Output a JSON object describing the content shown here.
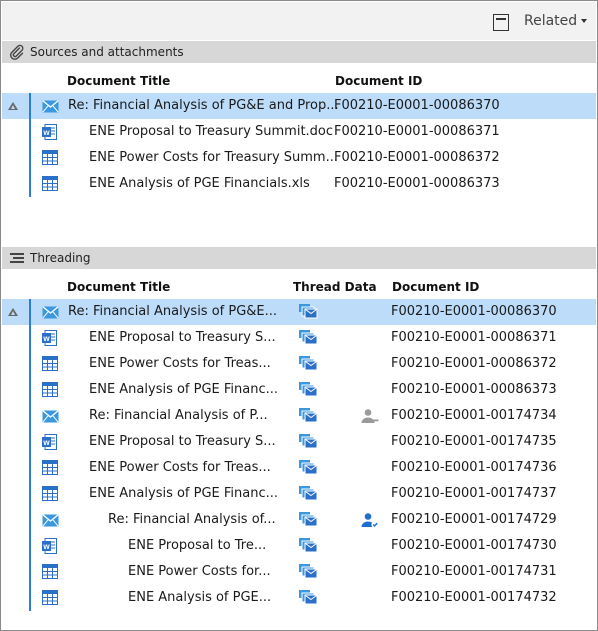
{
  "toolbar": {
    "related_label": "Related",
    "icons": {
      "panel_toggle": "panel-toggle-icon",
      "caret": "caret-down-icon"
    }
  },
  "sources": {
    "title": "Sources and attachments",
    "section_icon": "paperclip-icon",
    "columns": {
      "title": "Document Title",
      "doc_id": "Document ID"
    },
    "rows": [
      {
        "icon": "email-icon",
        "title": "Re: Financial Analysis of PG&E and Prop...",
        "doc_id": "F00210-E0001-00086370",
        "selected": true,
        "indent": 0
      },
      {
        "icon": "word-doc-icon",
        "title": "ENE Proposal to Treasury Summit.doc",
        "doc_id": "F00210-E0001-00086371",
        "indent": 1
      },
      {
        "icon": "spreadsheet-icon",
        "title": "ENE Power Costs for Treasury Summ...",
        "doc_id": "F00210-E0001-00086372",
        "indent": 1
      },
      {
        "icon": "spreadsheet-icon",
        "title": "ENE Analysis of PGE Financials.xls",
        "doc_id": "F00210-E0001-00086373",
        "indent": 1
      }
    ]
  },
  "threading": {
    "title": "Threading",
    "section_icon": "threading-icon",
    "columns": {
      "title": "Document Title",
      "thread_data": "Thread Data",
      "doc_id": "Document ID"
    },
    "rows": [
      {
        "icon": "email-icon",
        "title": "Re: Financial Analysis of PG&E...",
        "doc_id": "F00210-E0001-00086370",
        "selected": true,
        "indent": 0,
        "person": null
      },
      {
        "icon": "word-doc-icon",
        "title": "ENE Proposal to Treasury S...",
        "doc_id": "F00210-E0001-00086371",
        "indent": 1,
        "person": null
      },
      {
        "icon": "spreadsheet-icon",
        "title": "ENE Power Costs for Treas...",
        "doc_id": "F00210-E0001-00086372",
        "indent": 1,
        "person": null
      },
      {
        "icon": "spreadsheet-icon",
        "title": "ENE Analysis of PGE Financ...",
        "doc_id": "F00210-E0001-00086373",
        "indent": 1,
        "person": null
      },
      {
        "icon": "email-icon",
        "title": "Re: Financial Analysis of P...",
        "doc_id": "F00210-E0001-00174734",
        "indent": 1,
        "person": "gray"
      },
      {
        "icon": "word-doc-icon",
        "title": "ENE Proposal to Treasury S...",
        "doc_id": "F00210-E0001-00174735",
        "indent": 1,
        "person": null
      },
      {
        "icon": "spreadsheet-icon",
        "title": "ENE Power Costs for Treas...",
        "doc_id": "F00210-E0001-00174736",
        "indent": 1,
        "person": null
      },
      {
        "icon": "spreadsheet-icon",
        "title": "ENE Analysis of PGE Financ...",
        "doc_id": "F00210-E0001-00174737",
        "indent": 1,
        "person": null
      },
      {
        "icon": "email-icon",
        "title": "Re: Financial Analysis of...",
        "doc_id": "F00210-E0001-00174729",
        "indent": 2,
        "person": "blue"
      },
      {
        "icon": "word-doc-icon",
        "title": "ENE Proposal to Tre...",
        "doc_id": "F00210-E0001-00174730",
        "indent": 3,
        "person": null
      },
      {
        "icon": "spreadsheet-icon",
        "title": "ENE Power Costs for...",
        "doc_id": "F00210-E0001-00174731",
        "indent": 3,
        "person": null
      },
      {
        "icon": "spreadsheet-icon",
        "title": "ENE Analysis of PGE...",
        "doc_id": "F00210-E0001-00174732",
        "indent": 3,
        "person": null
      }
    ]
  },
  "colors": {
    "accent": "#2a7fd4",
    "selected_row": "#bcdcfa",
    "section_header": "#d7d7d7",
    "toolbar": "#f2f2f2",
    "email_icon": "#3a97e0",
    "doc_icon": "#2b6fc9",
    "person_gray": "#9a9a9a",
    "person_blue": "#1f6fd0"
  }
}
